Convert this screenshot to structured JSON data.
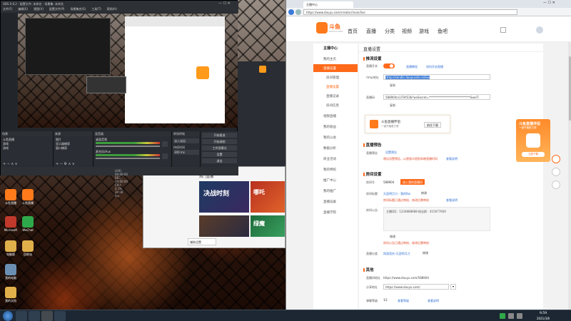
{
  "obs": {
    "title": "OBS 0.6.2 - 配置文件: 未命名 - 场景集: 未命名",
    "menu": [
      "文件(F)",
      "编辑(E)",
      "视图(V)",
      "配置文件(P)",
      "场景集合(S)",
      "工具(T)",
      "帮助(H)"
    ],
    "scenes_header": "场景",
    "sources_header": "来源",
    "mixer_header": "混音器",
    "transitions_header": "转场特效",
    "scenes": [
      "斗鱼直播",
      "游戏",
      "游戏"
    ],
    "sources": [
      "图片",
      "显示器捕获",
      "窗口捕获"
    ],
    "mixer": [
      "桌面音频",
      "麦克风/Aux"
    ],
    "transition_value": "淡入淡出",
    "duration_label": "持续时间",
    "duration_value": "300 ms",
    "controls": [
      "开始推流",
      "开始录制",
      "工作室模式",
      "设置",
      "退出"
    ],
    "status": "LIVE: 00:00:00   REC: 00:00:00   CPU: 4.1%, 30.00 fps"
  },
  "desktop_icons": [
    "斗鱼直播",
    "斗鱼直播",
    "Microsoft",
    "WeChat",
    "电脑版",
    "回收站",
    "我的电脑",
    "我的文档"
  ],
  "taskbar": {
    "time": "2021/3/8",
    "clock": "9:59"
  },
  "bg_window": {
    "section": "热门直播",
    "settings_btn": "辅助设置",
    "promo1": "决战时刻",
    "promo2": "哪吒",
    "promo3": "绿魔"
  },
  "browser": {
    "tab_title": "主播中心",
    "url": "https://www.douyu.com/creator/main/live",
    "logo": "斗鱼",
    "logo_sub": "DOUYU.COM",
    "nav": [
      "首页",
      "直播",
      "分类",
      "视频",
      "游戏",
      "鱼吧"
    ],
    "sidebar": [
      {
        "label": "主播中心",
        "header": true
      },
      {
        "label": "我的主页",
        "active": false
      },
      {
        "label": "直播设置",
        "active": true
      },
      {
        "label": "房间管理",
        "active": false
      },
      {
        "label": "直播设置",
        "active": false
      },
      {
        "label": "直播记录",
        "active": false
      },
      {
        "label": "房间信息",
        "active": false
      },
      {
        "label": "视频直播",
        "active": false
      },
      {
        "label": "我的收益",
        "active": false
      },
      {
        "label": "我的公会",
        "active": false
      },
      {
        "label": "数据分析",
        "active": false
      },
      {
        "label": "商业活动",
        "active": false
      },
      {
        "label": "我的特权",
        "active": false
      },
      {
        "label": "推广中心",
        "active": false
      },
      {
        "label": "我的推广",
        "active": false
      },
      {
        "label": "直播设备",
        "active": false
      },
      {
        "label": "直播学院",
        "active": false
      }
    ],
    "page_title": "直播设置",
    "push": {
      "title": "推流设置",
      "switch_label": "直播开关",
      "switch_link1": "直播教程",
      "switch_link2": "如何开启直播",
      "rtmp_label": "rtmp地址",
      "rtmp_value": "rtmp://sendtc.douyucdn.cn/live",
      "copy1": "复制",
      "code_label": "直播码",
      "code_value": "588904rx1l7Hf33b?wsSecret=*****************************&wsTi",
      "copy2": "复制",
      "download_title": "斗鱼直播伴侣",
      "download_sub": "一键开播更方便",
      "download_btn": "前往下载"
    },
    "preview": {
      "title": "直播预告",
      "label": "直播预告",
      "btn": "设置预告",
      "warn": "建议设置预告，以便观众提前知晓直播时间",
      "link": "查看说明"
    },
    "room": {
      "title": "房间设置",
      "id_label": "房间号",
      "id_value": "588904",
      "id_btn": "进入我的直播间",
      "name_label": "房间标题",
      "name_value": "天涯明月刀 - 我的Bui",
      "name_btn": "修改",
      "name_warn": "房间标题已通过审核，修改后需审核",
      "name_link": "查看说明",
      "notice_label": "房间公告",
      "notice_value": "主播QQ：1234888688  粉丝群：415677600",
      "notice_btn": "修改",
      "notice_warn": "房间公告已通过审核，修改后需审核",
      "cat_label": "直播分类",
      "cat_value": "网游竞技-天涯明月刀",
      "cat_btn": "修改"
    },
    "other": {
      "title": "其他",
      "url_label": "直播间地址",
      "url_value": "https://www.douyu.com/588904",
      "share_label": "分享地址",
      "share_value": "https://www.douyu.com/",
      "danmu_label": "弹幕等级",
      "danmu_value": "12",
      "danmu_link1": "查看等级",
      "danmu_link2": "查看说明"
    },
    "float_promo": {
      "title": "斗鱼直播伴侣",
      "sub": "一键开播更方便",
      "btn": "立即下载"
    }
  },
  "colors": {
    "accent": "#ff6a1a",
    "link": "#2f6fd6",
    "warn": "#e34b2a"
  }
}
